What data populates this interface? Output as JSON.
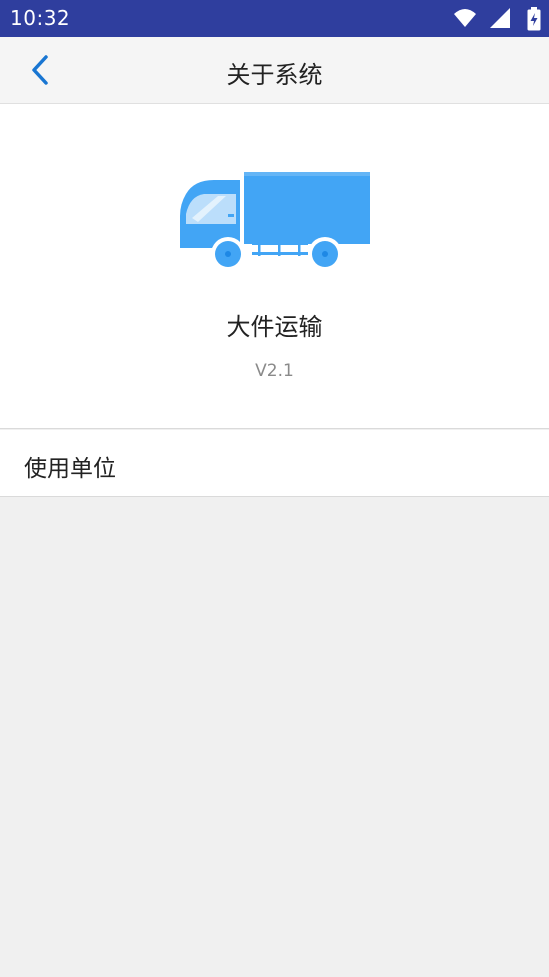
{
  "status_bar": {
    "time": "10:32",
    "icons": [
      "wifi-icon",
      "signal-icon",
      "battery-charging-icon"
    ]
  },
  "app_bar": {
    "back_icon": "chevron-left-icon",
    "title": "关于系统"
  },
  "about": {
    "logo_icon": "truck-icon",
    "app_name": "大件运输",
    "version": "V2.1"
  },
  "menu": {
    "org_label": "使用单位"
  },
  "colors": {
    "status_bar": "#2f3e9e",
    "accent": "#1976d2",
    "truck": "#42a5f5"
  }
}
